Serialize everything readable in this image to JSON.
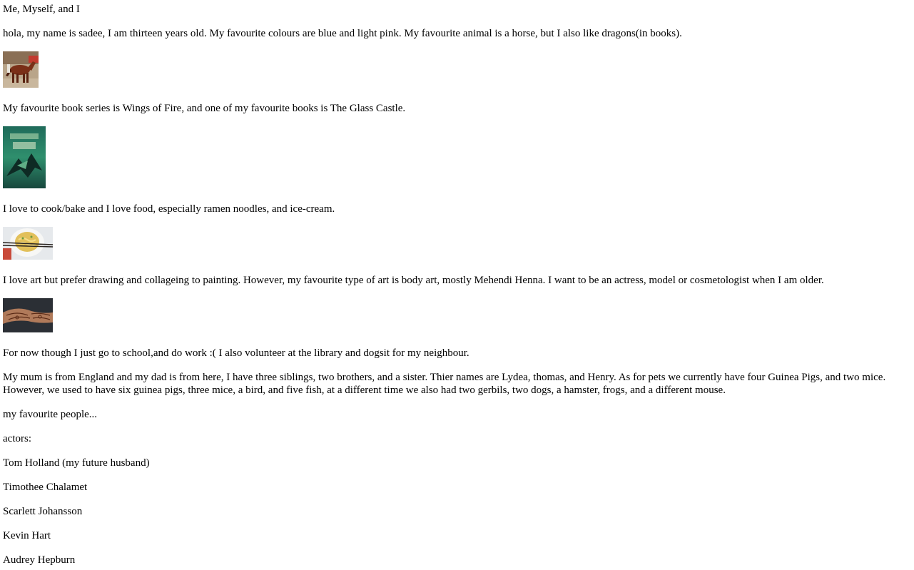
{
  "document": {
    "title": "Me, Myself, and I",
    "intro": "hola, my name is sadee, I am thirteen years old. My favourite colours are blue and light pink. My favourite animal is a horse, but I also like dragons(in books).",
    "books": "My favourite book series is Wings of Fire, and one of my favourite books is The Glass Castle.",
    "food": "I love to cook/bake and I love food, especially ramen noodles, and ice-cream.",
    "art": "I love art but prefer drawing and collageing to painting. However, my favourite type of art is body art, mostly Mehendi Henna. I want to be an actress, model or cosmetologist when I am older.",
    "now": "For now though I just go to school,and do work :( I also volunteer at the library and dogsit for my neighbour.",
    "family": "My mum is from England and my dad is from here, I have three siblings, two brothers, and a sister. Thier names are Lydea, thomas, and Henry. As for pets we currently have four Guinea Pigs, and two mice. However, we used to have six guinea pigs, three mice, a bird, and five fish, at a different time we also had two gerbils, two dogs, a hamster, frogs, and a different mouse.",
    "people_heading": "my favourite people...",
    "actors_heading": "actors:",
    "actors": [
      "Tom Holland (my future husband)",
      "Timothee Chalamet",
      "Scarlett Johansson",
      "Kevin Hart",
      "Audrey Hepburn"
    ]
  },
  "images": {
    "horse": "horse-photo",
    "book": "wings-of-fire-cover",
    "ramen": "ramen-bowl-photo",
    "henna": "henna-hands-photo"
  }
}
